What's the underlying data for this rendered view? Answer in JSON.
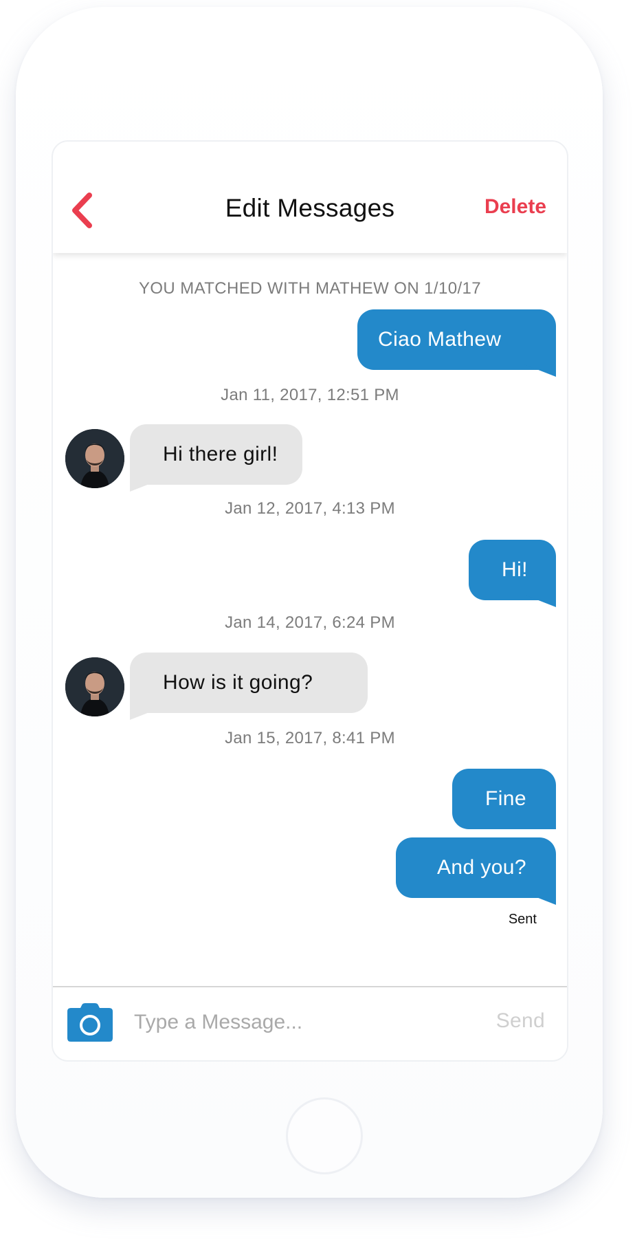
{
  "header": {
    "title": "Edit Messages",
    "delete_label": "Delete",
    "back_icon": "chevron-left-icon"
  },
  "conversation": {
    "match_note": "YOU MATCHED WITH MATHEW ON 1/10/17",
    "messages": [
      {
        "direction": "outgoing",
        "text": "Ciao Mathew"
      },
      {
        "timestamp": "Jan 11, 2017, 12:51 PM"
      },
      {
        "direction": "incoming",
        "text": "Hi there girl!"
      },
      {
        "timestamp": "Jan 12, 2017, 4:13 PM"
      },
      {
        "direction": "outgoing",
        "text": "Hi!"
      },
      {
        "timestamp": "Jan 14, 2017, 6:24 PM"
      },
      {
        "direction": "incoming",
        "text": "How is it going?"
      },
      {
        "timestamp": "Jan 15, 2017, 8:41 PM"
      },
      {
        "direction": "outgoing",
        "text": "Fine"
      },
      {
        "direction": "outgoing",
        "text": "And you?"
      }
    ],
    "status": "Sent"
  },
  "composer": {
    "placeholder": "Type a Message...",
    "send_label": "Send",
    "camera_icon": "camera-icon"
  },
  "colors": {
    "accent": "#ea3e4f",
    "outgoing_bubble": "#2389ca",
    "incoming_bubble": "#e6e6e6"
  }
}
